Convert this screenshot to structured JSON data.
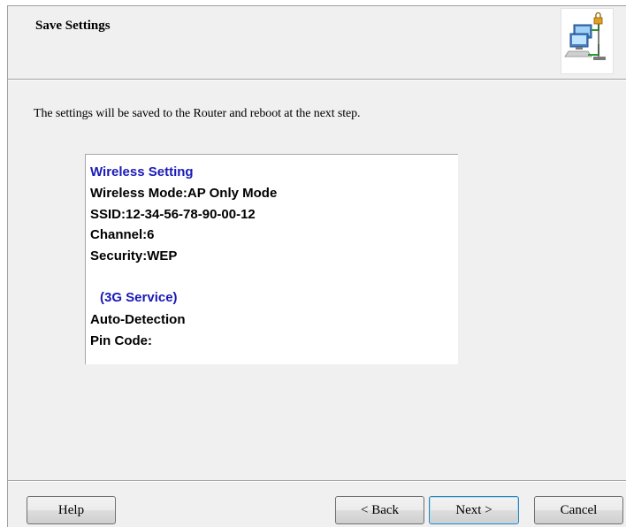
{
  "header": {
    "title": "Save Settings",
    "icon": "network-computers-icon"
  },
  "description": "The settings will be saved to the Router and reboot at the next step.",
  "summary": {
    "wireless_heading": "Wireless Setting",
    "wireless_mode": "Wireless Mode:AP Only Mode",
    "ssid": "SSID:12-34-56-78-90-00-12",
    "channel": "Channel:6",
    "security": "Security:WEP",
    "service_heading": "(3G Service)",
    "auto_detection": "Auto-Detection",
    "pin_code": "Pin Code:"
  },
  "buttons": {
    "help": "Help",
    "back": "< Back",
    "next": "Next >",
    "cancel": "Cancel"
  },
  "colors": {
    "dialog_background": "#f0f0f0",
    "heading_blue": "#1a1ab8",
    "default_button_border": "#3c7fb1"
  }
}
